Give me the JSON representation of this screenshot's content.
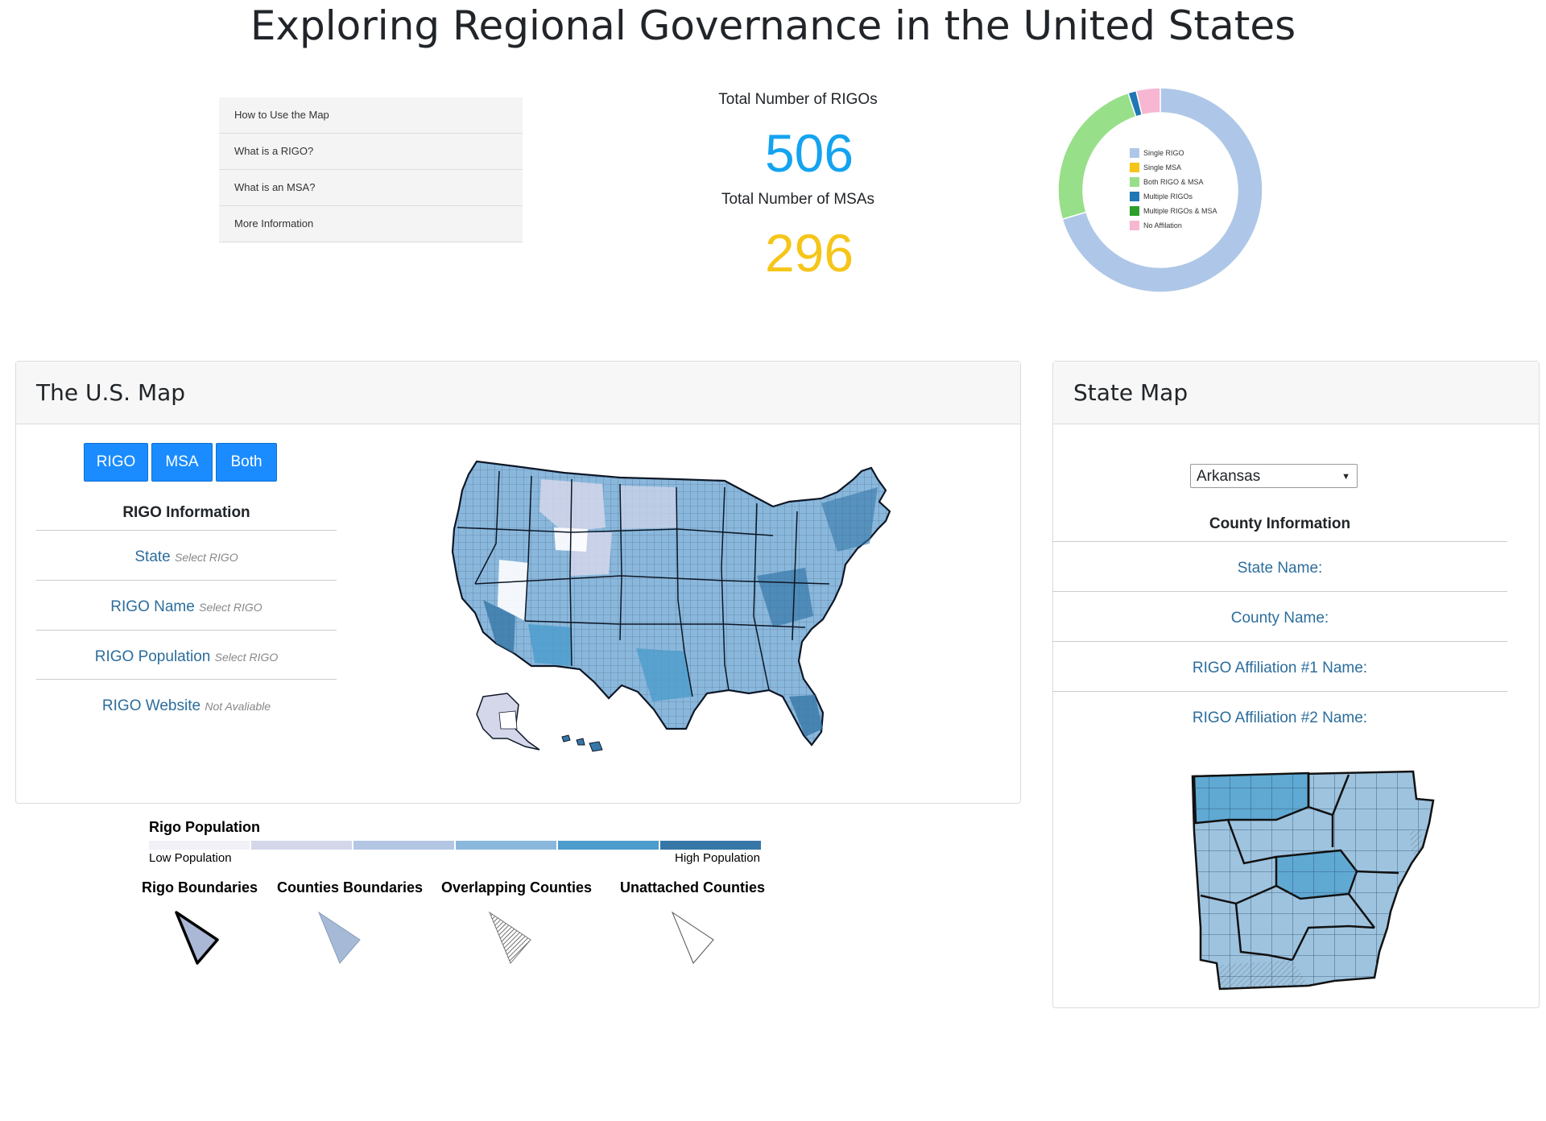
{
  "page": {
    "title": "Exploring Regional Governance in the United States"
  },
  "menu": {
    "items": [
      {
        "label": "How to Use the Map"
      },
      {
        "label": "What is a RIGO?"
      },
      {
        "label": "What is an MSA?"
      },
      {
        "label": "More Information"
      }
    ]
  },
  "totals": {
    "rigo_label": "Total Number of RIGOs",
    "rigo_value": "506",
    "msa_label": "Total Number of MSAs",
    "msa_value": "296",
    "rigo_color": "#14a3f0",
    "msa_color": "#f5c518"
  },
  "chart_data": {
    "type": "pie",
    "donut": true,
    "legend_position": "center",
    "slices": [
      {
        "label": "Single RIGO",
        "value": 0.704,
        "color": "#aec7e8"
      },
      {
        "label": "Single MSA",
        "value": 0.0,
        "color": "#f5c518"
      },
      {
        "label": "Both RIGO & MSA",
        "value": 0.245,
        "color": "#98df8a"
      },
      {
        "label": "Multiple RIGOs",
        "value": 0.013,
        "color": "#1f77b4"
      },
      {
        "label": "Multiple RIGOs & MSA",
        "value": 0.0,
        "color": "#2ca02c"
      },
      {
        "label": "No Affilation",
        "value": 0.038,
        "color": "#f7b6d2"
      }
    ]
  },
  "us_card": {
    "title": "The U.S. Map",
    "buttons": {
      "rigo": "RIGO",
      "msa": "MSA",
      "both": "Both"
    },
    "info_title": "RIGO Information",
    "rows": [
      {
        "label": "State",
        "value": "Select RIGO"
      },
      {
        "label": "RIGO Name",
        "value": "Select RIGO"
      },
      {
        "label": "RIGO Population",
        "value": "Select RIGO"
      },
      {
        "label": "RIGO Website",
        "value": "Not Avaliable"
      }
    ]
  },
  "state_card": {
    "title": "State Map",
    "selected_state": "Arkansas",
    "info_title": "County Information",
    "rows": [
      {
        "label": "State Name:"
      },
      {
        "label": "County Name:"
      },
      {
        "label": "RIGO Affiliation #1 Name:"
      },
      {
        "label": "RIGO Affiliation #2 Name:"
      }
    ]
  },
  "legend": {
    "population_title": "Rigo Population",
    "low": "Low Population",
    "high": "High Population",
    "scale_colors": [
      "#f1f0f7",
      "#d4d6ea",
      "#b3c6e4",
      "#8ab8dc",
      "#4c9ccc",
      "#3677a8"
    ],
    "boundaries": [
      {
        "label": "Rigo Boundaries"
      },
      {
        "label": "Counties Boundaries"
      },
      {
        "label": "Overlapping Counties"
      },
      {
        "label": "Unattached Counties"
      }
    ]
  }
}
